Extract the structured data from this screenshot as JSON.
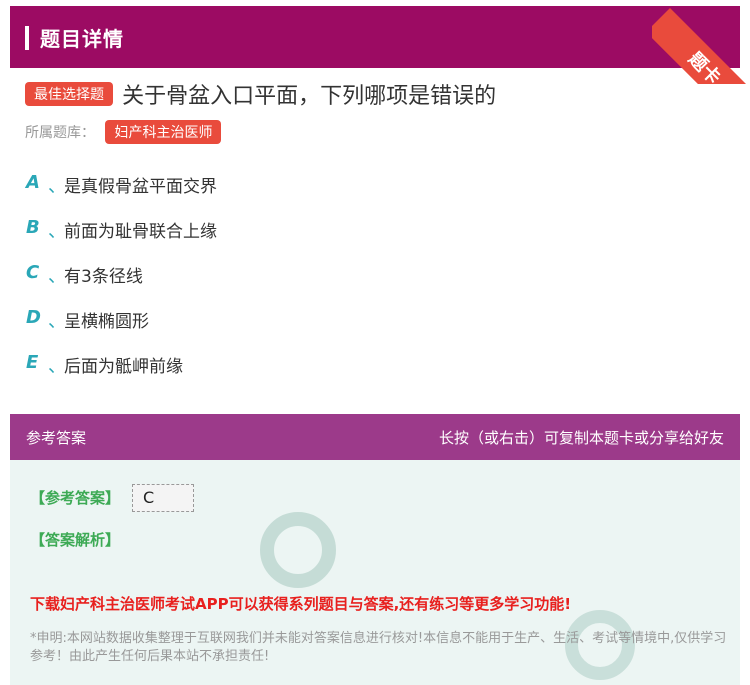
{
  "header": {
    "title": "题目详情",
    "ribbon": "题卡"
  },
  "question": {
    "type_tag": "最佳选择题",
    "text": "关于骨盆入口平面，下列哪项是错误的",
    "bank_label": "所属题库：",
    "bank_name": "妇产科主治医师"
  },
  "options": [
    {
      "letter": "A",
      "sep": "、",
      "text": "是真假骨盆平面交界"
    },
    {
      "letter": "B",
      "sep": "、",
      "text": "前面为耻骨联合上缘"
    },
    {
      "letter": "C",
      "sep": "、",
      "text": "有3条径线"
    },
    {
      "letter": "D",
      "sep": "、",
      "text": "呈横椭圆形"
    },
    {
      "letter": "E",
      "sep": "、",
      "text": "后面为骶岬前缘"
    }
  ],
  "answer": {
    "section_title": "参考答案",
    "copy_hint": "长按（或右击）可复制本题卡或分享给好友",
    "answer_label": "【参考答案】",
    "answer_value": "C",
    "analysis_label": "【答案解析】",
    "promo": "下载妇产科主治医师考试APP可以获得系列题目与答案,还有练习等更多学习功能!",
    "disclaimer": "*申明:本网站数据收集整理于互联网我们并未能对答案信息进行核对!本信息不能用于生产、生活、考试等情境中,仅供学习参考！由此产生任何后果本站不承担责任!"
  },
  "colors": {
    "header": "#9c0b63",
    "accent": "#e94b3c",
    "option_letter": "#2aa7b7",
    "answer_green": "#3daa55",
    "promo_red": "#e8201e"
  }
}
